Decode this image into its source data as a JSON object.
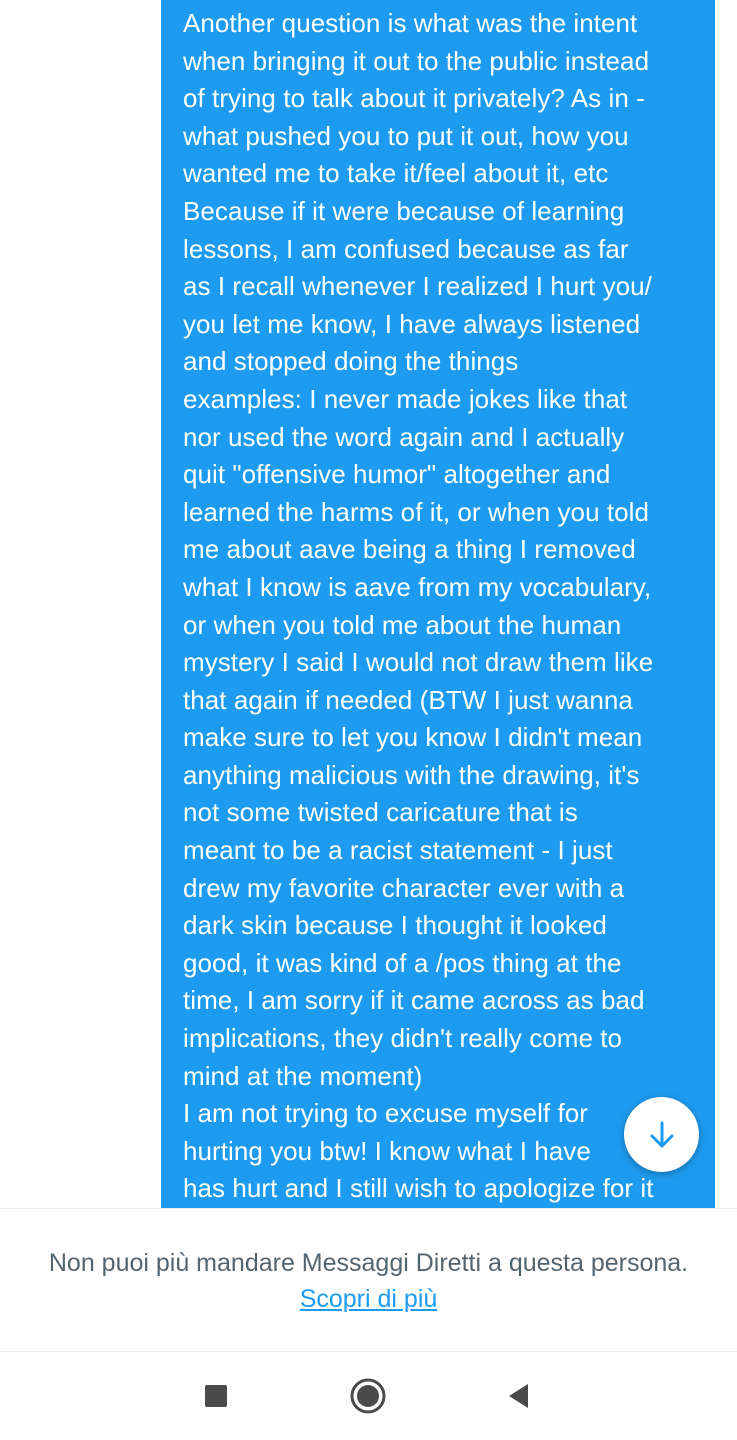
{
  "message": {
    "lines": [
      "Another question is what was the intent",
      "when bringing it out to the public instead",
      "of trying to talk about it privately? As in -",
      "what pushed you to put it out, how you",
      "wanted me to take it/feel about it, etc",
      "Because if it were because of learning",
      "lessons, I am confused because as far",
      "as I recall whenever I realized I hurt you/",
      "you let me know, I have always listened",
      "and stopped doing the things",
      "examples: I never made jokes like that",
      "nor used the word again and I actually",
      "quit \"offensive humor\" altogether and",
      "learned the harms of it, or when you told",
      "me about aave being a thing I removed",
      "what I know is aave from my vocabulary,",
      "or when you told me about the human",
      "mystery I said I would not draw them like",
      "that again if needed (BTW I just wanna",
      "make sure to let you know I didn't mean",
      "anything malicious with the drawing, it's",
      "not some twisted caricature that is",
      "meant to be a racist statement - I just",
      "drew my favorite character ever with a",
      "dark skin because I thought it looked",
      "good, it was kind of a /pos thing at the",
      "time, I am sorry if it came across as bad",
      "implications, they didn't really come to",
      "mind at the moment)",
      "I am not trying to excuse myself for",
      "hurting you btw! I know what I have",
      "has hurt and I still wish to apologize for it"
    ]
  },
  "scroll_button": {
    "icon": "arrow-down-icon"
  },
  "notice": {
    "text": "Non puoi più mandare Messaggi Diretti a questa persona.",
    "link": "Scopri di più"
  },
  "nav": {
    "recents_icon": "square-icon",
    "home_icon": "circle-icon",
    "back_icon": "triangle-back-icon"
  },
  "colors": {
    "bubble": "#1d9bf0",
    "link": "#1d9bf0",
    "notice_text": "#536471",
    "nav_icon": "#4a4a4a"
  }
}
